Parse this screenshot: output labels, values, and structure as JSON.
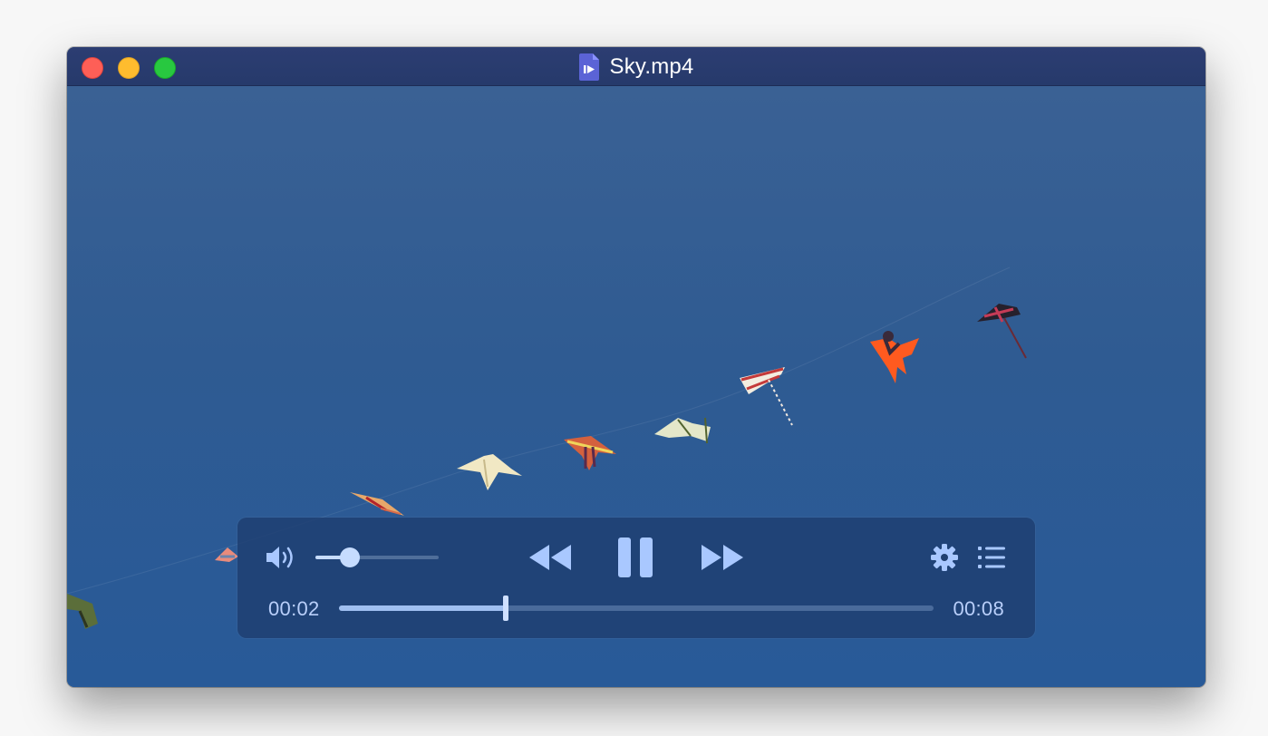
{
  "window": {
    "title": "Sky.mp4",
    "file_icon": "video-file-icon"
  },
  "player": {
    "current_time": "00:02",
    "duration": "00:08",
    "progress_fraction": 0.28,
    "volume_fraction": 0.28,
    "playing": true,
    "buttons": {
      "volume": "speaker-icon",
      "rewind": "rewind-icon",
      "pause": "pause-icon",
      "fast_forward": "fast-forward-icon",
      "settings": "gear-icon",
      "playlist": "list-icon"
    }
  },
  "colors": {
    "titlebar": "#263a6b",
    "sky": "#2f5b92",
    "controls_bg": "#1e3e70",
    "control_icon": "#a9c8ff",
    "time_text": "#b9cffa",
    "close": "#fe5f57",
    "minimize": "#febc2e",
    "zoom": "#28c840"
  }
}
